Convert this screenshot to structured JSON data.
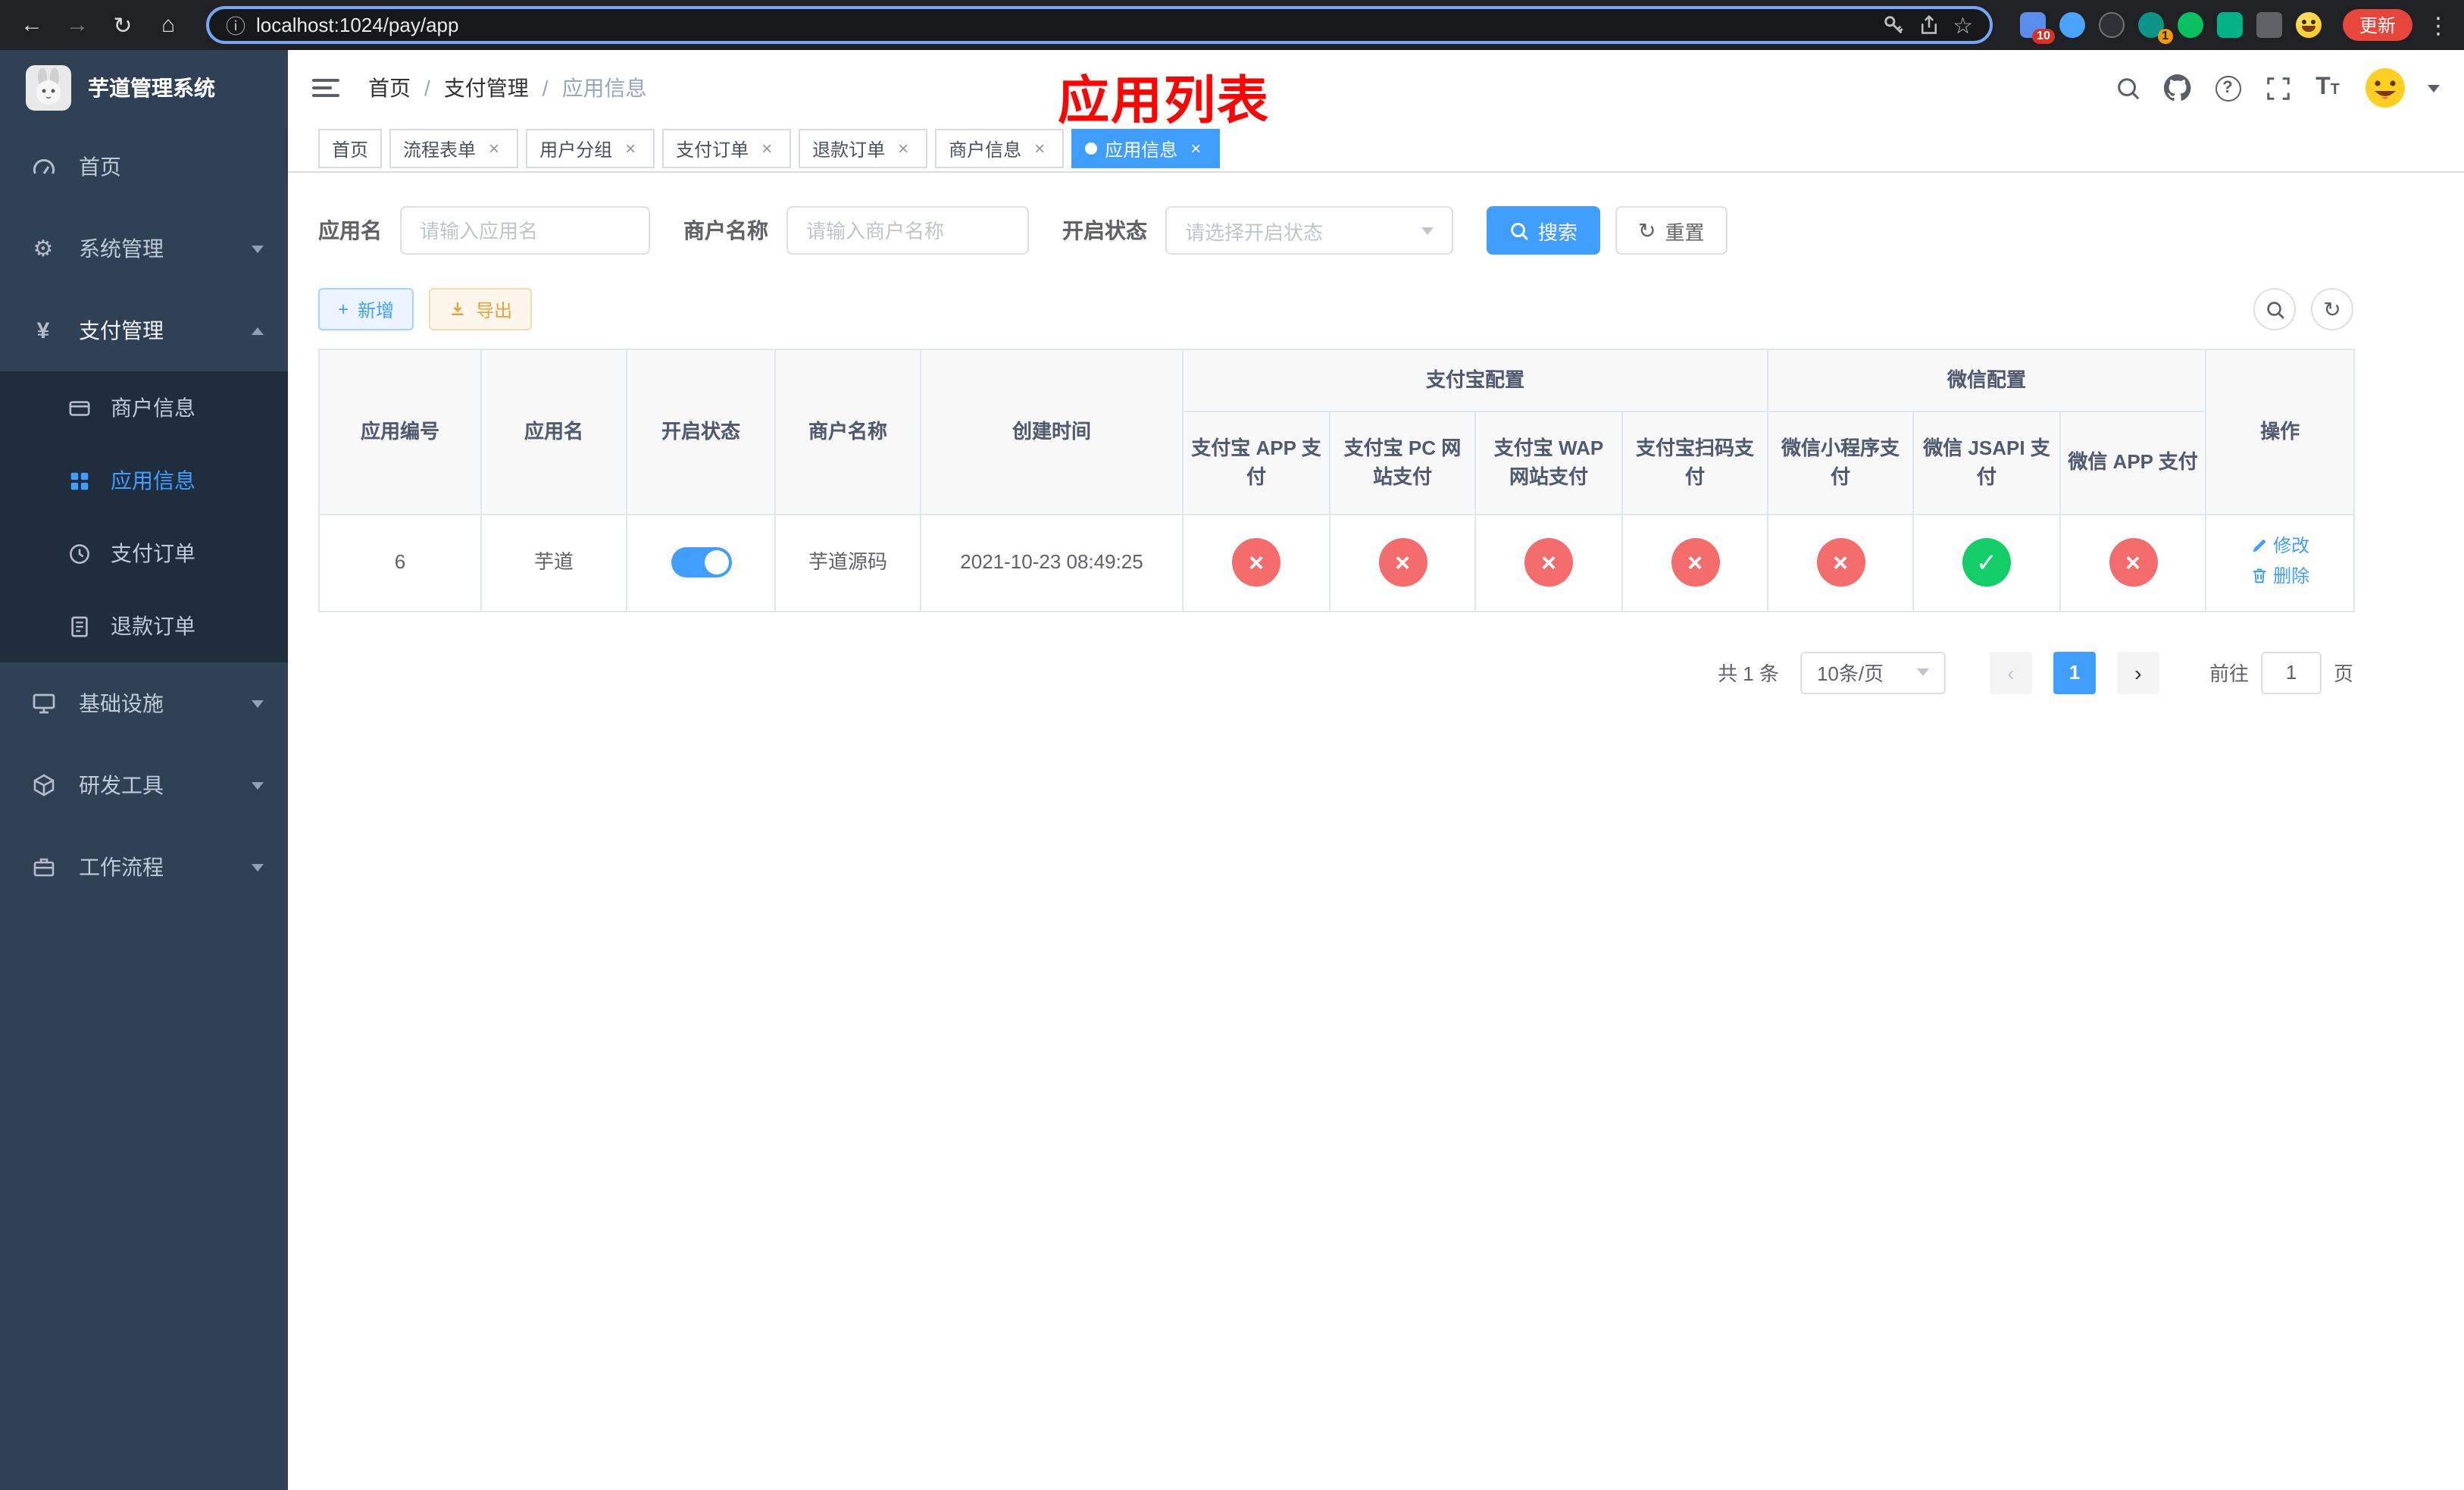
{
  "colors": {
    "accent": "#409eff",
    "success_circle": "#13ce66",
    "danger_circle": "#f56c6c",
    "sidebar_bg": "#304156",
    "submenu_bg": "#1f2d3d",
    "overlay_title_red": "#ff0202",
    "warning": "#e6a23c"
  },
  "icons": {
    "close": "×",
    "check": "✓",
    "cross": "×",
    "plus": "+",
    "refresh": "↻",
    "back": "←",
    "forward": "→",
    "home": "⌂",
    "info": "ⓘ",
    "dots": "⋮",
    "star": "☆",
    "gear": "⚙",
    "yen": "¥"
  },
  "browser": {
    "url": "localhost:1024/pay/app",
    "update_label": "更新",
    "ext_badge_puzzle": "10",
    "ext_badge_green": "1"
  },
  "sidebar": {
    "title": "芋道管理系统",
    "items": [
      {
        "label": "首页"
      },
      {
        "label": "系统管理"
      },
      {
        "label": "支付管理"
      },
      {
        "label": "基础设施"
      },
      {
        "label": "研发工具"
      },
      {
        "label": "工作流程"
      }
    ],
    "payment_children": [
      {
        "label": "商户信息"
      },
      {
        "label": "应用信息"
      },
      {
        "label": "支付订单"
      },
      {
        "label": "退款订单"
      }
    ]
  },
  "header": {
    "breadcrumb": [
      "首页",
      "支付管理",
      "应用信息"
    ],
    "separator": "/",
    "overlay_title": "应用列表"
  },
  "tabs": [
    {
      "label": "首页"
    },
    {
      "label": "流程表单"
    },
    {
      "label": "用户分组"
    },
    {
      "label": "支付订单"
    },
    {
      "label": "退款订单"
    },
    {
      "label": "商户信息"
    },
    {
      "label": "应用信息"
    }
  ],
  "filters": {
    "app_name_label": "应用名",
    "app_name_placeholder": "请输入应用名",
    "merchant_label": "商户名称",
    "merchant_placeholder": "请输入商户名称",
    "status_label": "开启状态",
    "status_placeholder": "请选择开启状态",
    "search_label": "搜索",
    "reset_label": "重置"
  },
  "toolbar": {
    "add_label": "新增",
    "export_label": "导出"
  },
  "table": {
    "columns": [
      "应用编号",
      "应用名",
      "开启状态",
      "商户名称",
      "创建时间"
    ],
    "group_alipay": {
      "label": "支付宝配置",
      "cols": [
        "支付宝 APP 支付",
        "支付宝 PC 网站支付",
        "支付宝 WAP 网站支付",
        "支付宝扫码支付"
      ]
    },
    "group_wechat": {
      "label": "微信配置",
      "cols": [
        "微信小程序支付",
        "微信 JSAPI 支付",
        "微信 APP 支付"
      ]
    },
    "action_col": "操作",
    "rows": [
      {
        "id": "6",
        "name": "芋道",
        "enabled": true,
        "merchant": "芋道源码",
        "created_at": "2021-10-23 08:49:25",
        "configs": [
          false,
          false,
          false,
          false,
          false,
          true,
          false
        ],
        "edit_label": "修改",
        "delete_label": "删除"
      }
    ]
  },
  "pagination": {
    "total": "共 1 条",
    "page_size": "10条/页",
    "current_page": "1",
    "goto_label": "前往",
    "goto_value": "1",
    "unit": "页"
  }
}
